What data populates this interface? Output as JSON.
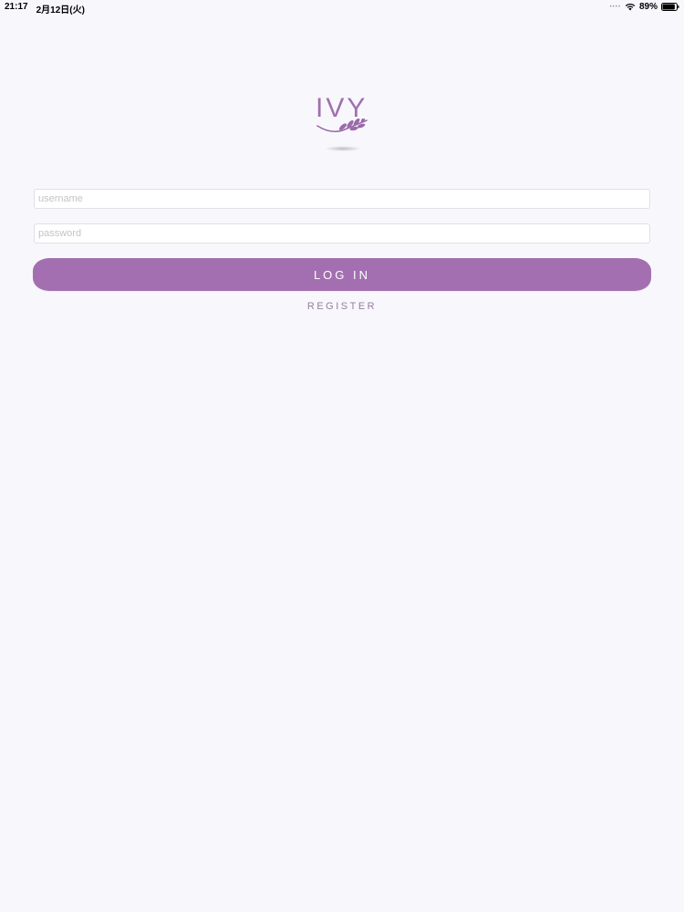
{
  "status_bar": {
    "time": "21:17",
    "date": "2月12日(火)",
    "battery_percent": "89%",
    "battery_level": 0.89
  },
  "logo": {
    "text": "IVY",
    "leaf_icon": "leaf-branch-icon"
  },
  "form": {
    "username_placeholder": "username",
    "password_placeholder": "password",
    "login_label": "LOG IN",
    "register_label": "REGISTER"
  },
  "colors": {
    "accent": "#a36fb0",
    "background": "#f8f8fc",
    "register_text": "#9a7aa4"
  }
}
